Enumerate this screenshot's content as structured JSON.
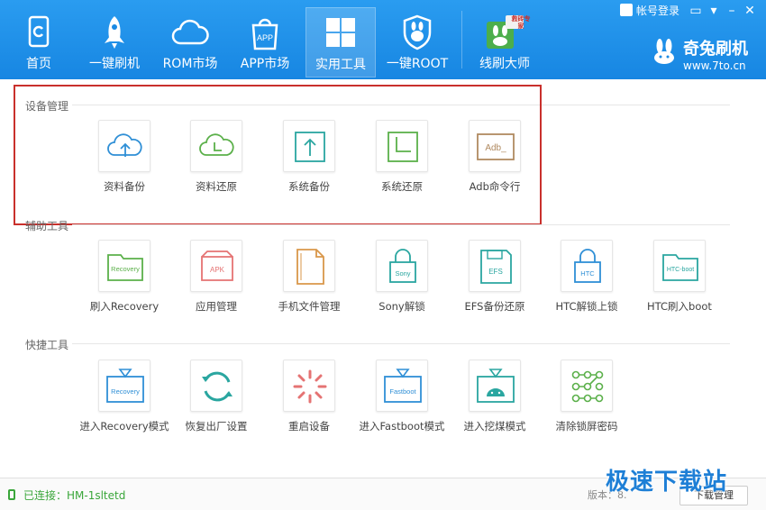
{
  "nav": [
    {
      "label": "首页",
      "icon": "home-icon"
    },
    {
      "label": "一键刷机",
      "icon": "rocket-icon"
    },
    {
      "label": "ROM市场",
      "icon": "cloud-icon"
    },
    {
      "label": "APP市场",
      "icon": "shopping-bag-icon",
      "badge": "APP"
    },
    {
      "label": "实用工具",
      "icon": "grid-icon",
      "active": true
    },
    {
      "label": "一键ROOT",
      "icon": "shield-rabbit-icon"
    },
    {
      "label": "线刷大师",
      "icon": "rabbit-master-icon",
      "badge": "救砖专家"
    }
  ],
  "topbar": {
    "user_label": "帐号登录"
  },
  "brand": {
    "name": "奇兔刷机",
    "url": "www.7to.cn"
  },
  "sections": {
    "device": "设备管理",
    "aux": "辅助工具",
    "quick": "快捷工具"
  },
  "device_tools": [
    {
      "label": "资料备份",
      "icon": "cloud-upload-icon"
    },
    {
      "label": "资料还原",
      "icon": "cloud-clock-icon"
    },
    {
      "label": "系统备份",
      "icon": "box-upload-icon"
    },
    {
      "label": "系统还原",
      "icon": "box-clock-icon"
    },
    {
      "label": "Adb命令行",
      "icon": "adb-terminal-icon",
      "text": "Adb_"
    }
  ],
  "aux_tools": [
    {
      "label": "刷入Recovery",
      "icon": "recovery-folder-icon",
      "text": "Recovery"
    },
    {
      "label": "应用管理",
      "icon": "apk-box-icon",
      "text": "APK"
    },
    {
      "label": "手机文件管理",
      "icon": "file-icon"
    },
    {
      "label": "Sony解锁",
      "icon": "sony-lock-icon",
      "text": "Sony"
    },
    {
      "label": "EFS备份还原",
      "icon": "efs-disk-icon",
      "text": "EFS"
    },
    {
      "label": "HTC解锁上锁",
      "icon": "htc-lock-icon",
      "text": "HTC"
    },
    {
      "label": "HTC刷入boot",
      "icon": "htc-boot-folder-icon",
      "text": "HTC-boot"
    }
  ],
  "quick_tools": [
    {
      "label": "进入Recovery模式",
      "icon": "recovery-mode-icon",
      "text": "Recovery"
    },
    {
      "label": "恢复出厂设置",
      "icon": "refresh-arrows-icon"
    },
    {
      "label": "重启设备",
      "icon": "loading-spinner-icon"
    },
    {
      "label": "进入Fastboot模式",
      "icon": "fastboot-mode-icon",
      "text": "Fastboot"
    },
    {
      "label": "进入挖煤模式",
      "icon": "android-download-icon"
    },
    {
      "label": "清除锁屏密码",
      "icon": "pattern-lock-icon"
    }
  ],
  "status": {
    "connection": "已连接：HM-1sltetd",
    "version": "版本：8.",
    "download_button": "下载管理"
  },
  "watermark": "极速下载站",
  "colors": {
    "header": "#1a8ae4",
    "highlight_border": "#c9302c",
    "connected": "#3aa63a",
    "blue": "#2f8fd6",
    "green": "#5bb04a",
    "teal": "#2aa6a0",
    "brown": "#b08a60",
    "red": "#e57373",
    "orange": "#d9974a"
  }
}
